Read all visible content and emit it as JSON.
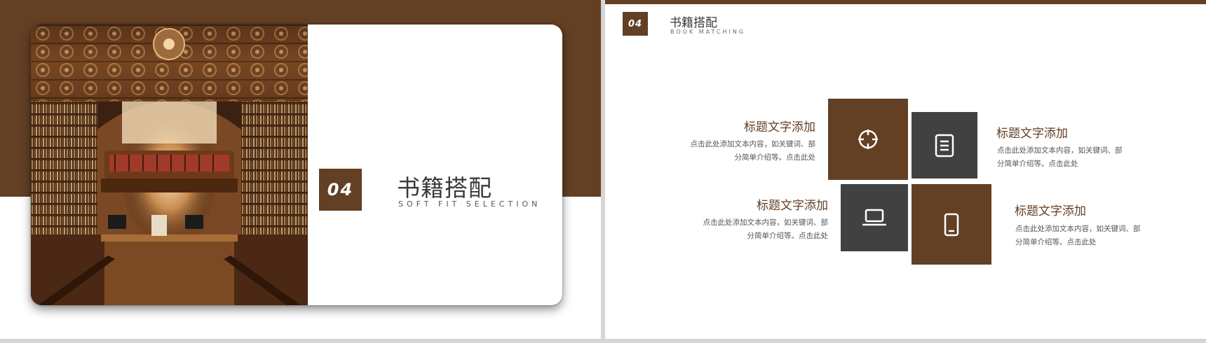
{
  "slide1": {
    "badge": "04",
    "title": "书籍搭配",
    "subtitle": "SOFT FIT SELECTION",
    "photo_icon": "library-interior-photo"
  },
  "slide2": {
    "badge": "04",
    "title": "书籍搭配",
    "subtitle": "BOOK MATCHING",
    "colors": {
      "brown": "#633f24",
      "gray": "#414141"
    },
    "blocks": [
      {
        "title": "标题文字添加",
        "line1": "点击此处添加文本内容，如关键词、部",
        "line2": "分简单介绍等。点击此处"
      },
      {
        "title": "标题文字添加",
        "line1": "点击此处添加文本内容，如关键词、部",
        "line2": "分简单介绍等。点击此处"
      },
      {
        "title": "标题文字添加",
        "line1": "点击此处添加文本内容，如关键词、部",
        "line2": "分简单介绍等。点击此处"
      },
      {
        "title": "标题文字添加",
        "line1": "点击此处添加文本内容，如关键词、部",
        "line2": "分简单介绍等。点击此处"
      }
    ],
    "tiles": [
      {
        "icon": "crosshair-icon",
        "color": "brown"
      },
      {
        "icon": "document-icon",
        "color": "gray"
      },
      {
        "icon": "laptop-icon",
        "color": "gray"
      },
      {
        "icon": "smartphone-icon",
        "color": "brown"
      }
    ]
  }
}
